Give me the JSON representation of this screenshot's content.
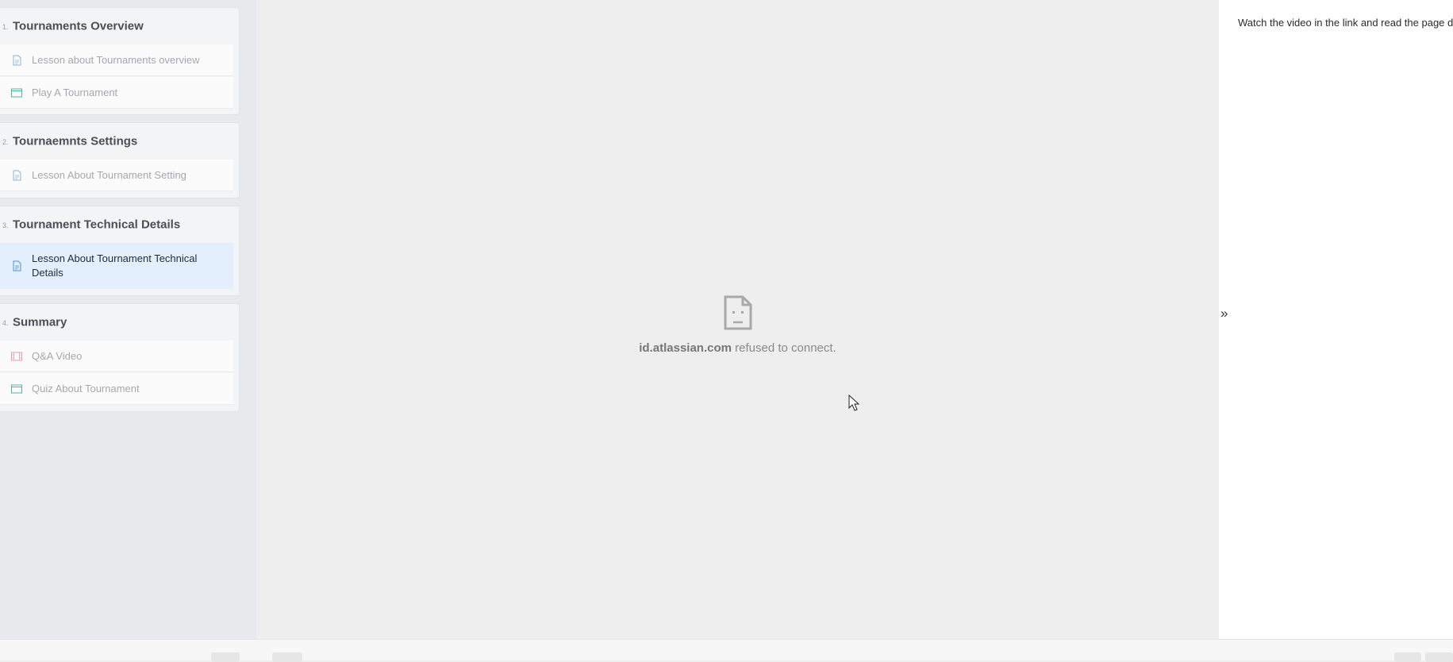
{
  "sidebar": {
    "sections": [
      {
        "num": "1.",
        "title": "Tournaments Overview",
        "lessons": [
          {
            "label": "Lesson about Tournaments overview",
            "icon": "document-icon"
          },
          {
            "label": "Play A Tournament",
            "icon": "browser-window-icon"
          }
        ]
      },
      {
        "num": "2.",
        "title": "Tournaemnts Settings",
        "lessons": [
          {
            "label": "Lesson About Tournament Setting",
            "icon": "document-icon"
          }
        ]
      },
      {
        "num": "3.",
        "title": "Tournament Technical Details",
        "lessons": [
          {
            "label": "Lesson About Tournament Technical Details",
            "icon": "document-icon",
            "active": true
          }
        ]
      },
      {
        "num": "4.",
        "title": "Summary",
        "lessons": [
          {
            "label": "Q&A Video",
            "icon": "film-icon"
          },
          {
            "label": "Quiz About Tournament",
            "icon": "browser-window-icon"
          }
        ]
      }
    ]
  },
  "main": {
    "error_host": "id.atlassian.com",
    "error_message": " refused to connect."
  },
  "right_panel": {
    "instructions": "Watch the video in the link and read the page data",
    "collapse_glyph": "»"
  },
  "colors": {
    "active_lesson_bg": "#e4effd",
    "document_icon": "#8ab0dc",
    "window_icon": "#4fb6a4",
    "film_icon": "#e2a0a8"
  }
}
